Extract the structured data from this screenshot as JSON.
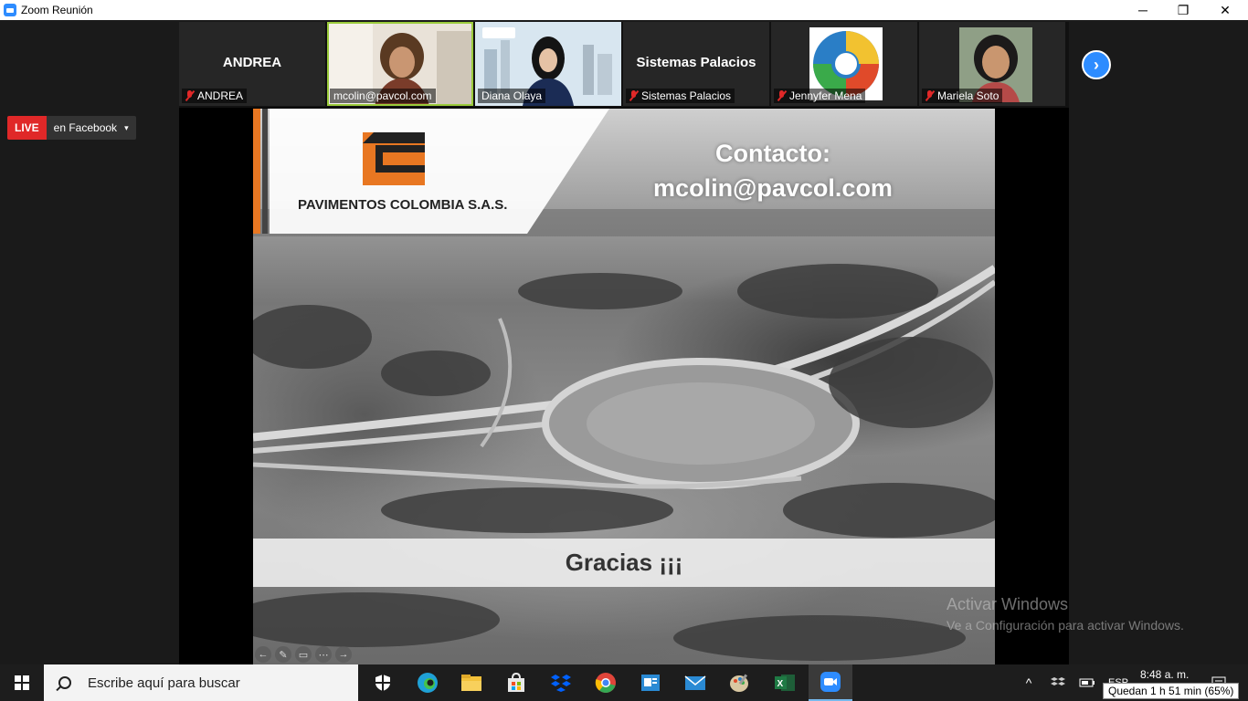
{
  "window": {
    "title": "Zoom Reunión",
    "minimize": "─",
    "restore": "❐",
    "close": "✕"
  },
  "participants": [
    {
      "big_name": "ANDREA",
      "name": "ANDREA",
      "muted": true,
      "video": false
    },
    {
      "big_name": "",
      "name": "mcolin@pavcol.com",
      "muted": false,
      "video": true,
      "active_speaker": true
    },
    {
      "big_name": "",
      "name": "Diana Olaya",
      "muted": false,
      "video": true
    },
    {
      "big_name": "Sistemas Palacios",
      "name": "Sistemas Palacios",
      "muted": true,
      "video": false
    },
    {
      "big_name": "",
      "name": "Jennyfer Mena",
      "muted": true,
      "video": false
    },
    {
      "big_name": "",
      "name": "Mariela Soto",
      "muted": true,
      "video": false
    }
  ],
  "next_page": "›",
  "live": {
    "tag": "LIVE",
    "where": "en Facebook",
    "caret": "▾"
  },
  "slide": {
    "company": "PAVIMENTOS COLOMBIA S.A.S.",
    "contact_line1": "Contacto:",
    "contact_line2": "mcolin@pavcol.com",
    "thanks": "Gracias ¡¡¡",
    "tools": [
      "←",
      "✎",
      "▭",
      "⋯",
      "→"
    ]
  },
  "watermark": {
    "line1": "Activar Windows",
    "line2": "Ve a Configuración para activar Windows."
  },
  "taskbar": {
    "search_placeholder": "Escribe aquí para buscar",
    "apps": [
      {
        "icon": "security-icon",
        "color": "#ffffff"
      },
      {
        "icon": "edge-icon",
        "color": "#1fa1d6"
      },
      {
        "icon": "file-explorer-icon",
        "color": "#f3c13a"
      },
      {
        "icon": "store-icon",
        "color": "#e8e8e8"
      },
      {
        "icon": "dropbox-icon",
        "color": "#0061fe"
      },
      {
        "icon": "chrome-icon",
        "color": "#e0453a"
      },
      {
        "icon": "outlook-contacts-icon",
        "color": "#2a8ad4"
      },
      {
        "icon": "mail-icon",
        "color": "#2a8ad4"
      },
      {
        "icon": "paint-icon",
        "color": "#c8b48a"
      },
      {
        "icon": "excel-icon",
        "color": "#1f7a44"
      },
      {
        "icon": "zoom-icon",
        "color": "#2d8cff"
      }
    ],
    "tray_chevron": "^",
    "lang": "ESP",
    "time": "8:48 a. m.",
    "battery_tooltip": "Quedan 1 h 51 min (65%)"
  }
}
